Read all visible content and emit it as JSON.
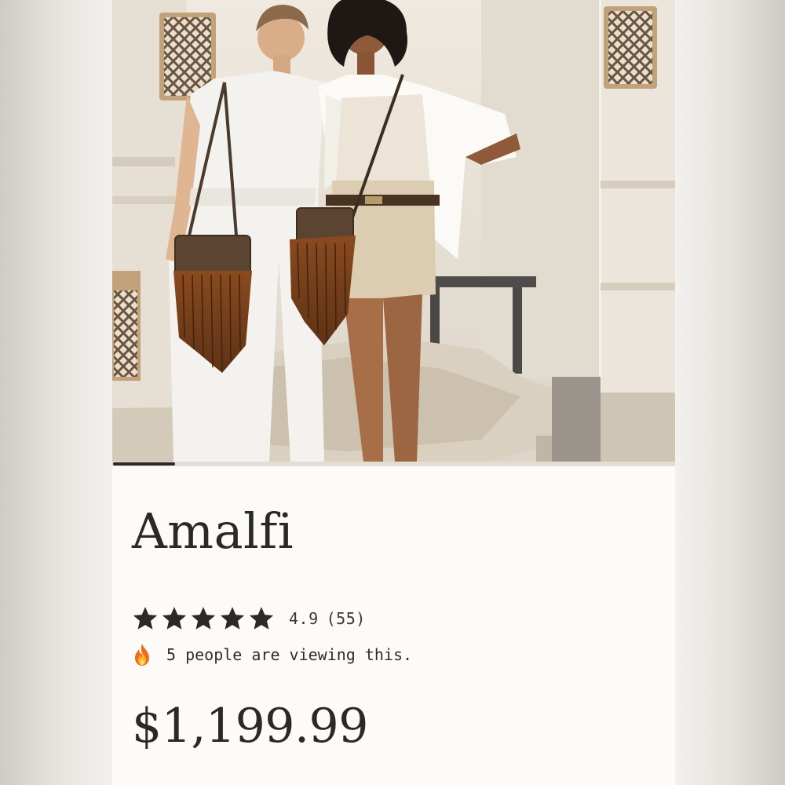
{
  "product": {
    "title": "Amalfi",
    "rating": {
      "stars": 5,
      "score": "4.9",
      "count": "(55)",
      "star_color": "#2c2a28"
    },
    "viewers": {
      "icon": "fire-icon",
      "text": "5 people are viewing this."
    },
    "price": "$1,199.99"
  },
  "gallery": {
    "image_alt": "Two models wearing fringe crossbody bags",
    "progress": 0.11,
    "accent": "#2c2a28"
  }
}
